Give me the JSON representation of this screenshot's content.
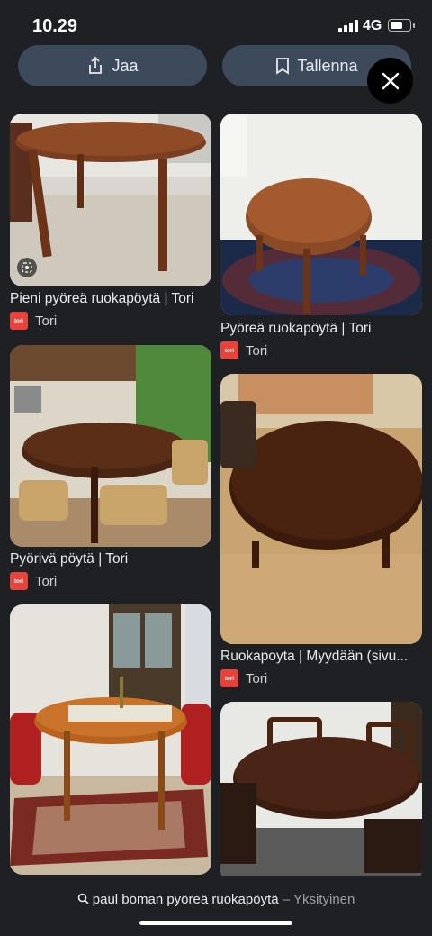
{
  "status_bar": {
    "time": "10.29",
    "network": "4G"
  },
  "actions": {
    "share_label": "Jaa",
    "save_label": "Tallenna"
  },
  "results": [
    {
      "title": "Pieni pyöreä ruokapöytä | Tori",
      "source": "Tori"
    },
    {
      "title": "Pyöreä ruokapöytä | Tori",
      "source": "Tori"
    },
    {
      "title": "Pyörivä pöytä | Tori",
      "source": "Tori"
    },
    {
      "title": "Ruokapoyta | Myydään (sivu...",
      "source": "Tori"
    },
    {
      "title": "",
      "source": ""
    },
    {
      "title": "",
      "source": ""
    }
  ],
  "source_logo_text": "tori",
  "search_bar": {
    "query": "paul boman pyöreä ruokapöytä",
    "separator": " – ",
    "subtitle": "Yksityinen"
  },
  "colors": {
    "background": "#1f2023",
    "button": "#3c4a5c",
    "tori_brand": "#e8433a"
  }
}
